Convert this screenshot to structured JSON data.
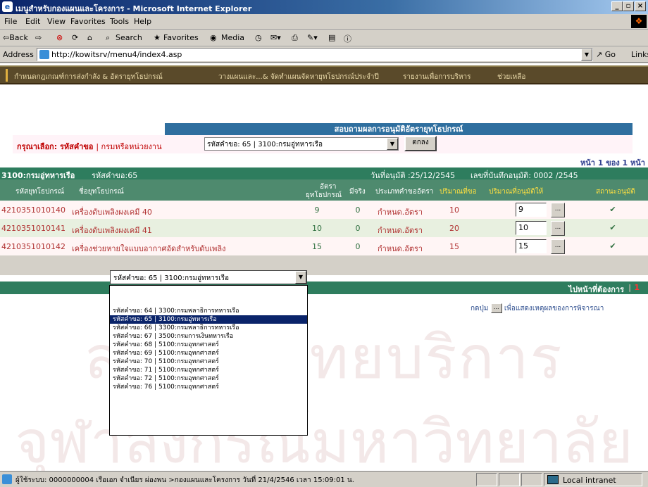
{
  "window": {
    "title": "เมนูสำหรับกองแผนและโครงการ - Microsoft Internet Explorer",
    "controls": [
      "_",
      "▫",
      "×"
    ]
  },
  "menubar": [
    "File",
    "Edit",
    "View",
    "Favorites",
    "Tools",
    "Help"
  ],
  "toolbar": {
    "back": "⇦Back",
    "forward": "⇨",
    "search": "Search",
    "favorites": "Favorites",
    "media": "Media"
  },
  "address": {
    "label": "Address",
    "url": "http://kowitsrv/menu4/index4.asp",
    "go": "Go",
    "links": "Links"
  },
  "sitenav": [
    "กำหนดกฎเกณฑ์การส่งกำลัง & อัตรายุทโธปกรณ์",
    "วางแผนและ...& จัดทำแผนจัดหายุทโธปกรณ์ประจำปี",
    "รายงานเพื่อการบริหาร",
    "ช่วยเหลือ"
  ],
  "panel": {
    "heading": "สอบถามผลการอนุมัติอัตรายุทโธปกรณ์",
    "select_label_prefix": "กรุณาเลือก:",
    "select_label_main": "รหัสคำขอ",
    "select_label_suffix": "| กรมหรือหน่วยงาน",
    "selected_value": "รหัสคำขอ:  65  | 3100:กรมอู่ทหารเรือ",
    "ok_button": "ตกลง",
    "page_info": "หน้า  1  ของ  1  หน้า"
  },
  "info": {
    "dept": "3100:กรมอู่ทหารเรือ",
    "req_label": "รหัสคำขอ:65",
    "approve_date": "วันที่อนุมัติ :25/12/2545",
    "record_no": "เลขที่บันทึกอนุมัติ: 0002 /2545"
  },
  "columns": {
    "code": "รหัสยุทโธปกรณ์",
    "name": "ชื่อยุทโธปกรณ์",
    "rate_1": "อัตรา",
    "rate_2": "ยุทโธปกรณ์",
    "actual": "มีจริง",
    "type": "ประเภทคำขออัตรา",
    "req_qty": "ปริมาณที่ขอ",
    "appr_qty": "ปริมาณที่อนุมัติให้",
    "status": "สถานะอนุมัติ"
  },
  "rows": [
    {
      "code": "4210351010140",
      "name": "เครื่องดับเพลิงผงเคมี 40",
      "rate": "9",
      "actual": "0",
      "type": "กำหนด.อัตรา",
      "req": "10",
      "appr": "9",
      "dots": "...",
      "status": "✔"
    },
    {
      "code": "4210351010141",
      "name": "เครื่องดับเพลิงผงเคมี 41",
      "rate": "10",
      "actual": "0",
      "type": "กำหนด.อัตรา",
      "req": "20",
      "appr": "10",
      "dots": "...",
      "status": "✔"
    },
    {
      "code": "4210351010142",
      "name": "เครื่องช่วยหายใจแบบอากาศอัดสำหรับดับเพลิง",
      "rate": "15",
      "actual": "0",
      "type": "กำหนด.อัตรา",
      "req": "15",
      "appr": "15",
      "dots": "...",
      "status": "✔"
    }
  ],
  "goto": {
    "label": "ไปหน้าที่ต้องการ",
    "sep": "|",
    "page": "1"
  },
  "hint": {
    "prefix": "กดปุ่ม",
    "button": "...",
    "suffix": "เพื่อแสดงเหตุผลของการพิจารณา"
  },
  "popup": {
    "selected": "รหัสคำขอ:  65  | 3100:กรมอู่ทหารเรือ",
    "options": [
      "",
      "รหัสคำขอ:  64  | 3300:กรมพลาธิการทหารเรือ",
      "รหัสคำขอ:  65  | 3100:กรมอู่ทหารเรือ",
      "รหัสคำขอ:  66  | 3300:กรมพลาธิการทหารเรือ",
      "รหัสคำขอ:  67  | 3500:กรมการเงินทหารเรือ",
      "รหัสคำขอ:  68  | 5100:กรมอุทกศาสตร์",
      "รหัสคำขอ:  69  | 5100:กรมอุทกศาสตร์",
      "รหัสคำขอ:  70  | 5100:กรมอุทกศาสตร์",
      "รหัสคำขอ:  71  | 5100:กรมอุทกศาสตร์",
      "รหัสคำขอ:  72  | 5100:กรมอุทกศาสตร์",
      "รหัสคำขอ:  76  | 5100:กรมอุทกศาสตร์"
    ],
    "selected_index": 2
  },
  "watermark": {
    "line1": "สถาบันวิทยบริการ",
    "line2": "จุฬาลงกรณ์มหาวิทยาลัย"
  },
  "status": {
    "text": "ผู้ใช้ระบบ: 0000000004 เรือเอก จำเนียร ผ่องพน >กองแผนและโครงการ วันที่ 21/4/2546 เวลา 15:09:01 น.",
    "zone": "Local intranet"
  }
}
